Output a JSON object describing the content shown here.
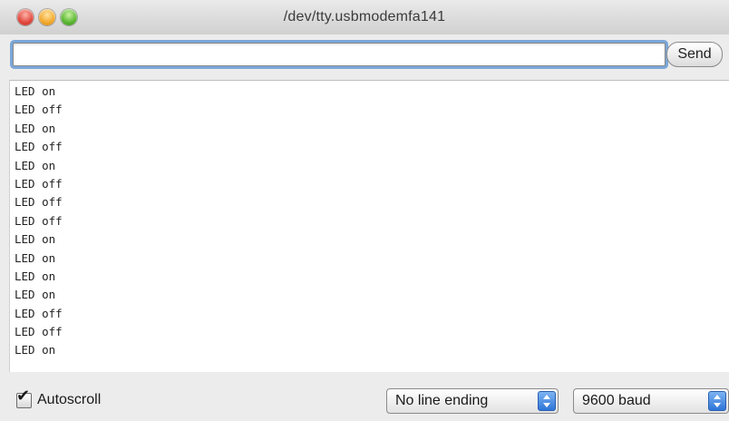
{
  "window": {
    "title": "/dev/tty.usbmodemfa141"
  },
  "input": {
    "value": "",
    "send_label": "Send"
  },
  "output": {
    "lines": [
      "LED on",
      "LED off",
      "LED on",
      "LED off",
      "LED on",
      "LED off",
      "LED off",
      "LED off",
      "LED on",
      "LED on",
      "LED on",
      "LED on",
      "LED off",
      "LED off",
      "LED on"
    ]
  },
  "footer": {
    "autoscroll_label": "Autoscroll",
    "autoscroll_checked": true,
    "line_ending": "No line ending",
    "baud_rate": "9600 baud"
  },
  "icons": {
    "close": "close-icon",
    "minimize": "minimize-icon",
    "zoom": "zoom-icon",
    "checkmark": "checkmark-icon",
    "stepper": "up-down-arrows-icon"
  },
  "colors": {
    "close": "#e0443a",
    "minimize": "#f2a72a",
    "zoom": "#58b52f",
    "focus_ring": "#7aa7d9",
    "stepper": "#2e75d8"
  }
}
